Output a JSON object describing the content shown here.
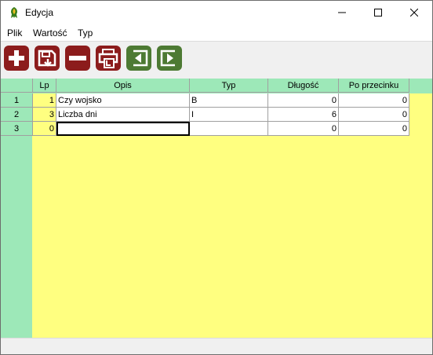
{
  "window": {
    "title": "Edycja"
  },
  "menu": {
    "items": [
      "Plik",
      "Wartość",
      "Typ"
    ]
  },
  "toolbar": {
    "buttons": [
      {
        "name": "add",
        "icon": "plus-icon",
        "color": "#8c1c1c"
      },
      {
        "name": "save",
        "icon": "save-icon",
        "color": "#8c1c1c"
      },
      {
        "name": "delete",
        "icon": "minus-icon",
        "color": "#8c1c1c"
      },
      {
        "name": "print",
        "icon": "print-icon",
        "color": "#8c1c1c"
      },
      {
        "name": "back",
        "icon": "arrow-left-icon",
        "color": "#4d7a33"
      },
      {
        "name": "forward",
        "icon": "arrow-right-icon",
        "color": "#4d7a33"
      }
    ]
  },
  "table": {
    "columns": [
      "Lp",
      "Opis",
      "Typ",
      "Długość",
      "Po przecinku"
    ],
    "rows": [
      {
        "row": "1",
        "lp": "1",
        "opis": "Czy wojsko",
        "typ": "B",
        "dlugosc": "0",
        "po_przecinku": "0"
      },
      {
        "row": "2",
        "lp": "3",
        "opis": "Liczba dni",
        "typ": "I",
        "dlugosc": "6",
        "po_przecinku": "0"
      },
      {
        "row": "3",
        "lp": "0",
        "opis": "",
        "typ": "",
        "dlugosc": "0",
        "po_przecinku": "0"
      }
    ]
  },
  "colors": {
    "header_bg": "#9de8b8",
    "grid_bg": "#ffff80",
    "button_red": "#8c1c1c",
    "button_green": "#4d7a33"
  }
}
